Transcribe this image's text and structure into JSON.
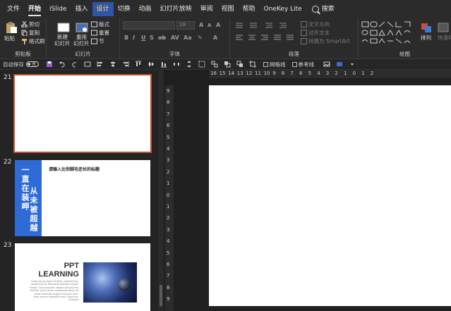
{
  "menubar": {
    "items": [
      "文件",
      "开始",
      "iSlide",
      "插入",
      "设计",
      "切换",
      "动画",
      "幻灯片放映",
      "审阅",
      "视图",
      "帮助",
      "OneKey Lite"
    ],
    "active_index": 1,
    "hover_index": 4,
    "search_label": "搜索"
  },
  "ribbon": {
    "clipboard": {
      "paste": "粘贴",
      "cut": "剪切",
      "copy": "复制",
      "format_painter": "格式刷",
      "label": "剪贴板"
    },
    "slides": {
      "new_slide": "新建",
      "new_slide2": "幻灯片",
      "reuse": "重用",
      "reuse2": "幻灯片",
      "layout": "版式",
      "reset": "重置",
      "section": "节",
      "label": "幻灯片"
    },
    "font": {
      "size": "18",
      "label": "字体"
    },
    "paragraph": {
      "text_direction": "文字方向",
      "align_text": "对齐文本",
      "smartart": "转换为 SmartArt",
      "label": "段落"
    },
    "drawing": {
      "arrange": "排列",
      "quick_styles": "快速样式",
      "label": "绘图"
    }
  },
  "qat": {
    "autosave": "自动保存",
    "toggle_state": "关",
    "gridlines": "网格线",
    "guides": "参考线"
  },
  "slides": [
    {
      "number": "21"
    },
    {
      "number": "22",
      "vtext1": "一直在装呷",
      "vtext2": "从未被超越",
      "title": "请输入比你脚毛还长的标题"
    },
    {
      "number": "23",
      "title1": "PPT",
      "title2": "LEARNING",
      "body": "Lorem ipsum dolor sit amet, consectetuer adipiscing elit. Maecenas porttitor congue massa. Fusce posuere, magna sed pulvinar ultricies, purus lectus malesuada libero, sit amet commodo magna eros quis urna. Nunc viverra imperdiet enim. Fusce est. Vivamus"
    }
  ],
  "hruler_labels": [
    "16",
    "15",
    "14",
    "13",
    "12",
    "11",
    "10",
    "9",
    "8",
    "7",
    "6",
    "5",
    "4",
    "3",
    "2",
    "1",
    "0",
    "1",
    "2"
  ],
  "vruler_labels": [
    "9",
    "8",
    "7",
    "6",
    "5",
    "4",
    "3",
    "2",
    "1",
    "0",
    "1",
    "2",
    "3",
    "4",
    "5",
    "6",
    "7",
    "8",
    "9"
  ],
  "colors": {
    "accent_hover": "#2e55a8",
    "selected_outline": "#c4532b",
    "slide22_bar": "#2f6bd6"
  }
}
